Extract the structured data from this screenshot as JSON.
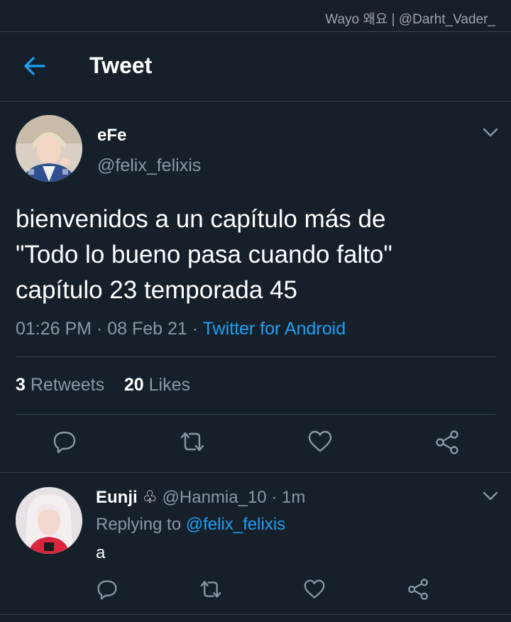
{
  "watermark": "Wayo 왜요 | @Darht_Vader_",
  "header": {
    "title": "Tweet"
  },
  "tweet": {
    "display_name": "eFe",
    "handle": "@felix_felixis",
    "text_lines": [
      "bienvenidos a un capítulo más de",
      "\"Todo lo bueno pasa cuando falto\"",
      "capítulo 23 temporada 45"
    ],
    "time": "01:26 PM",
    "date": "08 Feb 21",
    "source": "Twitter for Android",
    "retweets_count": "3",
    "retweets_label": "Retweets",
    "likes_count": "20",
    "likes_label": "Likes"
  },
  "reply": {
    "display_name": "Eunji",
    "badge": "♧",
    "handle": "@Hanmia_10",
    "time": "1m",
    "replying_prefix": "Replying to",
    "replying_to": "@felix_felixis",
    "text": "a"
  },
  "separators": {
    "dot": "·"
  },
  "colors": {
    "background": "#15202b",
    "accent": "#1da1f2",
    "muted": "#8899a6",
    "divider": "#38444d"
  },
  "icons": [
    "back-arrow-icon",
    "chevron-down-icon",
    "reply-icon",
    "retweet-icon",
    "like-icon",
    "share-icon"
  ]
}
